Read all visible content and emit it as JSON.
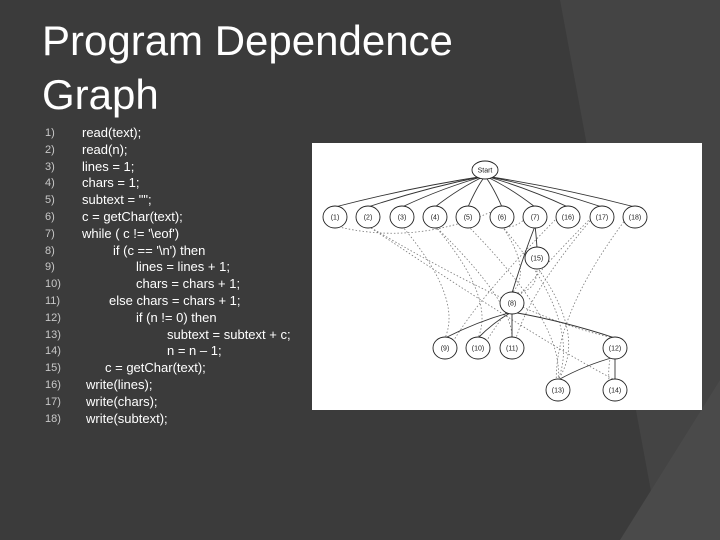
{
  "slide": {
    "title_line1": "Program Dependence",
    "title_line2": "Graph"
  },
  "code": [
    {
      "num": "1)",
      "text": "read(text);"
    },
    {
      "num": "2)",
      "text": "read(n);"
    },
    {
      "num": "3)",
      "text": "lines = 1;"
    },
    {
      "num": "4)",
      "text": "chars = 1;"
    },
    {
      "num": "5)",
      "text": "subtext = \"\";"
    },
    {
      "num": "6)",
      "text": "c = getChar(text);"
    },
    {
      "num": "7)",
      "text": "while ( c != '\\eof')"
    },
    {
      "num": "8)",
      "text": "if (c == '\\n') then"
    },
    {
      "num": "9)",
      "text": "lines = lines + 1;"
    },
    {
      "num": "10)",
      "text": "chars = chars + 1;"
    },
    {
      "num": "11)",
      "text": "else chars = chars + 1;"
    },
    {
      "num": "12)",
      "text": "if (n != 0) then"
    },
    {
      "num": "13)",
      "text": "subtext = subtext + c;"
    },
    {
      "num": "14)",
      "text": "n = n – 1;"
    },
    {
      "num": "15)",
      "text": "c = getChar(text);"
    },
    {
      "num": "16)",
      "text": "write(lines);"
    },
    {
      "num": "17)",
      "text": "write(chars);"
    },
    {
      "num": "18)",
      "text": "write(subtext);"
    }
  ],
  "graph": {
    "nodes": [
      "Start",
      "(1)",
      "(2)",
      "(3)",
      "(4)",
      "(5)",
      "(6)",
      "(7)",
      "(16)",
      "(17)",
      "(18)",
      "(15)",
      "(8)",
      "(9)",
      "(10)",
      "(11)",
      "(12)",
      "(13)",
      "(14)"
    ],
    "control_edges": [
      [
        "Start",
        "(1)"
      ],
      [
        "Start",
        "(2)"
      ],
      [
        "Start",
        "(3)"
      ],
      [
        "Start",
        "(4)"
      ],
      [
        "Start",
        "(5)"
      ],
      [
        "Start",
        "(6)"
      ],
      [
        "Start",
        "(7)"
      ],
      [
        "Start",
        "(16)"
      ],
      [
        "Start",
        "(17)"
      ],
      [
        "Start",
        "(18)"
      ],
      [
        "(7)",
        "(8)"
      ],
      [
        "(7)",
        "(15)"
      ],
      [
        "(8)",
        "(9)"
      ],
      [
        "(8)",
        "(10)"
      ],
      [
        "(8)",
        "(11)"
      ],
      [
        "(8)",
        "(12)"
      ],
      [
        "(12)",
        "(13)"
      ],
      [
        "(12)",
        "(14)"
      ]
    ],
    "data_edges": [
      [
        "(1)",
        "(6)"
      ],
      [
        "(2)",
        "(12)"
      ],
      [
        "(3)",
        "(9)"
      ],
      [
        "(4)",
        "(10)"
      ],
      [
        "(4)",
        "(11)"
      ],
      [
        "(5)",
        "(13)"
      ],
      [
        "(6)",
        "(7)"
      ],
      [
        "(6)",
        "(8)"
      ],
      [
        "(6)",
        "(13)"
      ],
      [
        "(15)",
        "(8)"
      ],
      [
        "(15)",
        "(13)"
      ],
      [
        "(9)",
        "(16)"
      ],
      [
        "(10)",
        "(17)"
      ],
      [
        "(11)",
        "(17)"
      ],
      [
        "(13)",
        "(18)"
      ],
      [
        "(14)",
        "(12)"
      ],
      [
        "(2)",
        "(14)"
      ]
    ],
    "colors": {
      "background": "#ffffff",
      "edge": "#333333"
    }
  }
}
